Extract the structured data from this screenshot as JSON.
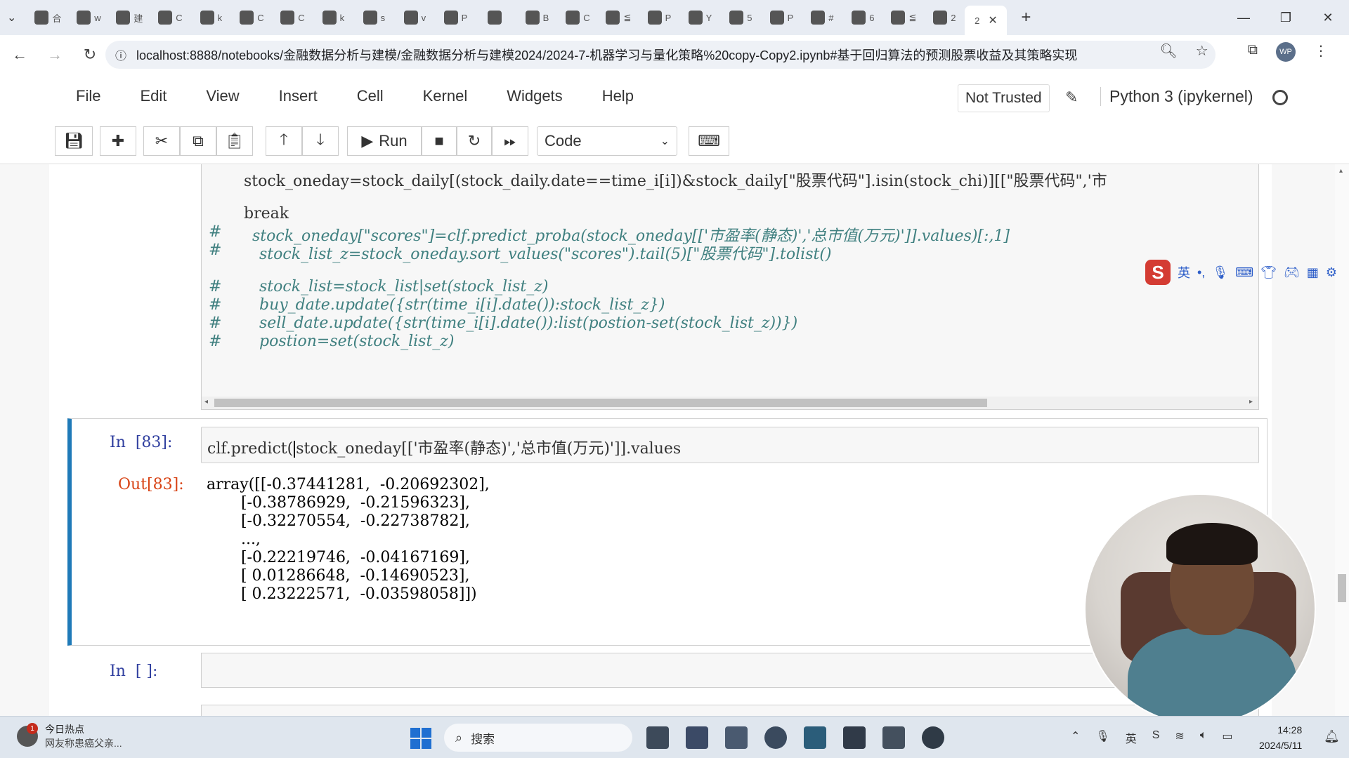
{
  "browser": {
    "tabs": [
      {
        "icon": "tab-app-icon",
        "label": "合"
      },
      {
        "icon": "github-icon",
        "label": "w"
      },
      {
        "icon": "vscode-icon",
        "label": "建"
      },
      {
        "icon": "tab-app-icon",
        "label": "C"
      },
      {
        "icon": "github-icon",
        "label": "k"
      },
      {
        "icon": "cube-icon",
        "label": "C"
      },
      {
        "icon": "tab-app-icon",
        "label": "C"
      },
      {
        "icon": "github-icon",
        "label": "k"
      },
      {
        "icon": "tab-app-icon",
        "label": "s"
      },
      {
        "icon": "github-icon",
        "label": "v"
      },
      {
        "icon": "tab-app-icon",
        "label": "P"
      },
      {
        "icon": "cloud-icon",
        "label": ""
      },
      {
        "icon": "cloud-icon",
        "label": "B"
      },
      {
        "icon": "github-icon",
        "label": "C"
      },
      {
        "icon": "tab-app-icon",
        "label": "≦"
      },
      {
        "icon": "tab-app-icon",
        "label": "P"
      },
      {
        "icon": "youtube-icon",
        "label": "Y"
      },
      {
        "icon": "tab-app-icon",
        "label": "5"
      },
      {
        "icon": "google-icon",
        "label": "P"
      },
      {
        "icon": "tab-app-icon",
        "label": "#"
      },
      {
        "icon": "tab-app-icon",
        "label": "6"
      },
      {
        "icon": "tab-app-icon",
        "label": "≦"
      },
      {
        "icon": "tab-app-icon",
        "label": "2"
      }
    ],
    "active_tab_label": "2",
    "new_tab": "+",
    "url": "localhost:8888/notebooks/金融数据分析与建模/金融数据分析与建模2024/2024-7-机器学习与量化策略%20copy-Copy2.ipynb#基于回归算法的预测股票收益及其策略实现",
    "profile_initials": "WP"
  },
  "jupyter": {
    "menus": [
      "File",
      "Edit",
      "View",
      "Insert",
      "Cell",
      "Kernel",
      "Widgets",
      "Help"
    ],
    "trust_status": "Not Trusted",
    "kernel_name": "Python 3 (ipykernel)",
    "run_label": "Run",
    "cell_type": "Code"
  },
  "cell_above": {
    "lines": [
      {
        "hash": "",
        "text": "stock_oneday=stock_daily[(stock_daily.date==time_i[i])&stock_daily[\"股票代码\"].isin(stock_chi)][[\"股票代码\",'市"
      },
      {
        "hash": "",
        "text": "break"
      },
      {
        "hash": "#",
        "text": "stock_oneday[\"scores\"]=clf.predict_proba(stock_oneday[['市盈率(静态)','总市值(万元)']].values)[:,1]"
      },
      {
        "hash": "#",
        "text": "stock_list_z=stock_oneday.sort_values(\"scores\").tail(5)[\"股票代码\"].tolist()"
      },
      {
        "hash": "#",
        "text": "stock_list=stock_list|set(stock_list_z)"
      },
      {
        "hash": "#",
        "text": "buy_date.update({str(time_i[i].date()):stock_list_z})"
      },
      {
        "hash": "#",
        "text": "sell_date.update({str(time_i[i].date()):list(postion-set(stock_list_z))})"
      },
      {
        "hash": "#",
        "text": "postion=set(stock_list_z)"
      }
    ]
  },
  "cell_current": {
    "in_prompt": "In  [83]:",
    "code_before_cursor": "clf.predict(",
    "code_after_cursor": "stock_oneday[['市盈率(静态)','总市值(万元)']].values",
    "out_prompt": "Out[83]:",
    "output_lines": [
      "array([[-0.37441281,  -0.20692302],",
      "       [-0.38786929,  -0.21596323],",
      "       [-0.32270554,  -0.22738782],",
      "       ...,",
      "       [-0.22219746,  -0.04167169],",
      "       [ 0.01286648,  -0.14690523],",
      "       [ 0.23222571,  -0.03598058]])"
    ]
  },
  "cell_empty": {
    "in_prompt": "In  [ ]:"
  },
  "ime": {
    "mode": "英",
    "symbols": "•,"
  },
  "taskbar": {
    "news_title": "今日热点",
    "news_sub": "网友称患癌父亲...",
    "news_badge": "1",
    "search_placeholder": "搜索",
    "time": "14:28",
    "date": "2024/5/11"
  }
}
